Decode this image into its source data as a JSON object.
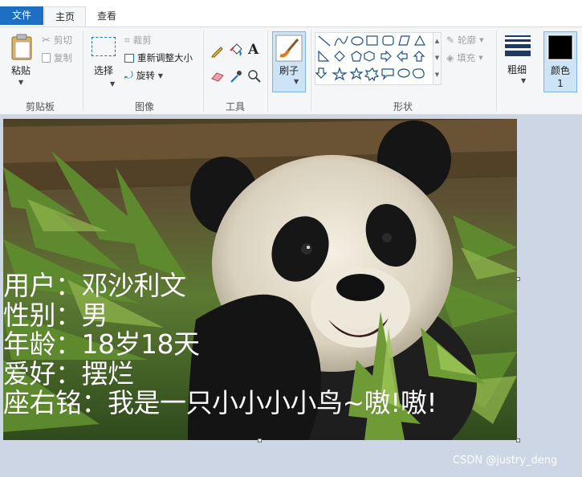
{
  "tabs": {
    "file": "文件",
    "home": "主页",
    "view": "查看"
  },
  "clipboard": {
    "paste": "粘贴",
    "cut": "剪切",
    "copy": "复制",
    "label": "剪贴板"
  },
  "image": {
    "select": "选择",
    "crop": "裁剪",
    "resize": "重新调整大小",
    "rotate": "旋转",
    "label": "图像"
  },
  "tools": {
    "label": "工具",
    "text_glyph": "A"
  },
  "brushes": {
    "label": "刷子"
  },
  "shapes": {
    "outline": "轮廓",
    "fill": "填充",
    "label": "形状"
  },
  "size": {
    "label": "粗细"
  },
  "color1": {
    "label": "颜色 1",
    "value": "#000000"
  },
  "canvas": {
    "lines": [
      "用户：邓沙利文",
      "性别：男",
      "年龄：18岁18天",
      "爱好：摆烂",
      "座右铭：我是一只小小小小鸟~嗷!嗷!"
    ],
    "text_color": "#ffffff"
  },
  "watermark": "CSDN @justry_deng",
  "colors": {
    "accent": "#1c6fc3",
    "ribbon_bg": "#f5f6f7",
    "workspace_bg": "#cdd6e4"
  }
}
